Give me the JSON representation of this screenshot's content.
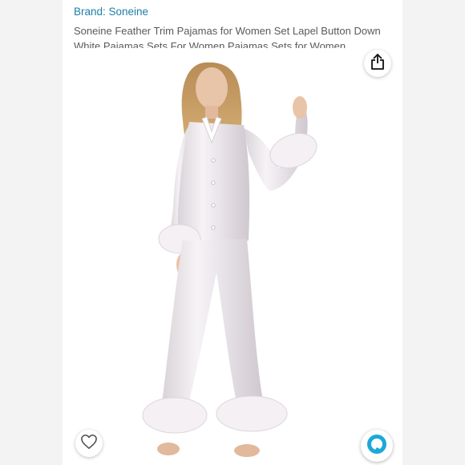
{
  "header": {
    "brand_label": "Brand: Soneine",
    "product_title": "Soneine Feather Trim Pajamas for Women Set Lapel Button Down White Pajamas Sets For Women Pajamas Sets for Women"
  },
  "icons": {
    "share": "share-icon",
    "wishlist": "heart-icon",
    "assistant": "alexa-icon"
  },
  "colors": {
    "brand_link": "#1f7fa6",
    "alexa": "#1ca8d8"
  }
}
